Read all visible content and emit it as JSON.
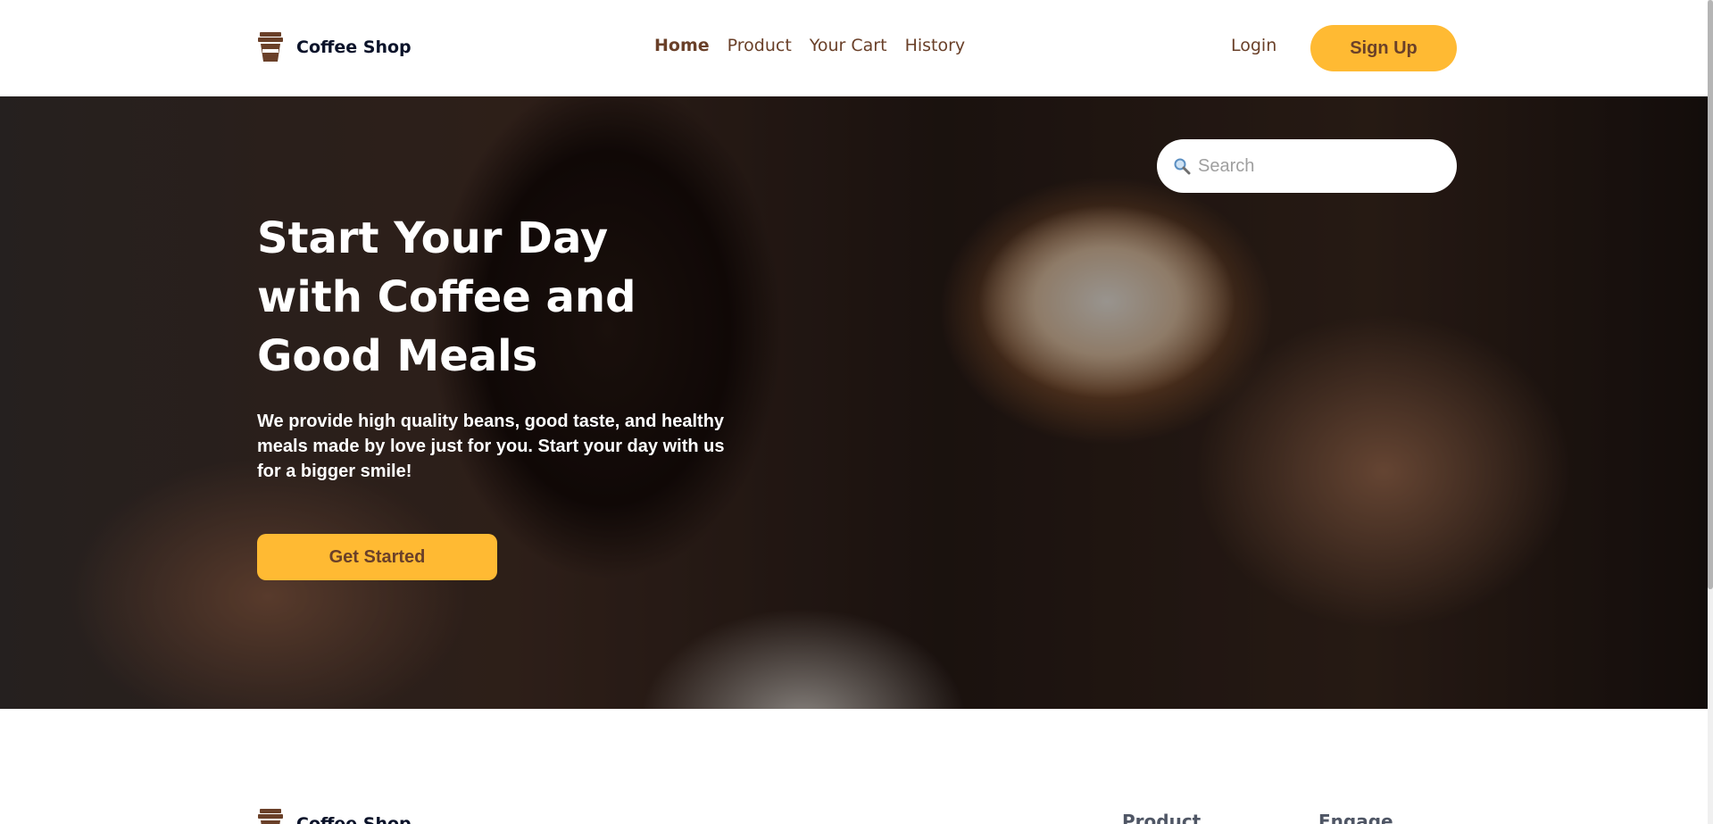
{
  "brand": {
    "name": "Coffee Shop",
    "logo_icon": "coffee-cup-icon"
  },
  "nav": {
    "items": [
      {
        "label": "Home",
        "active": true
      },
      {
        "label": "Product",
        "active": false
      },
      {
        "label": "Your Cart",
        "active": false
      },
      {
        "label": "History",
        "active": false
      }
    ]
  },
  "auth": {
    "login_label": "Login",
    "signup_label": "Sign Up"
  },
  "hero": {
    "title": "Start Your Day with Coffee and Good Meals",
    "description": "We provide high quality beans, good taste, and healthy meals made by love just for you. Start your day with us for a bigger smile!",
    "cta_label": "Get Started"
  },
  "search": {
    "placeholder": "Search",
    "icon": "search-icon"
  },
  "footer": {
    "brand_name": "Coffee Shop",
    "columns": [
      {
        "title": "Product"
      },
      {
        "title": "Engage"
      }
    ]
  },
  "colors": {
    "accent": "#ffba33",
    "brown": "#6a4029",
    "dark": "#0b132a",
    "muted": "#4f5665"
  }
}
